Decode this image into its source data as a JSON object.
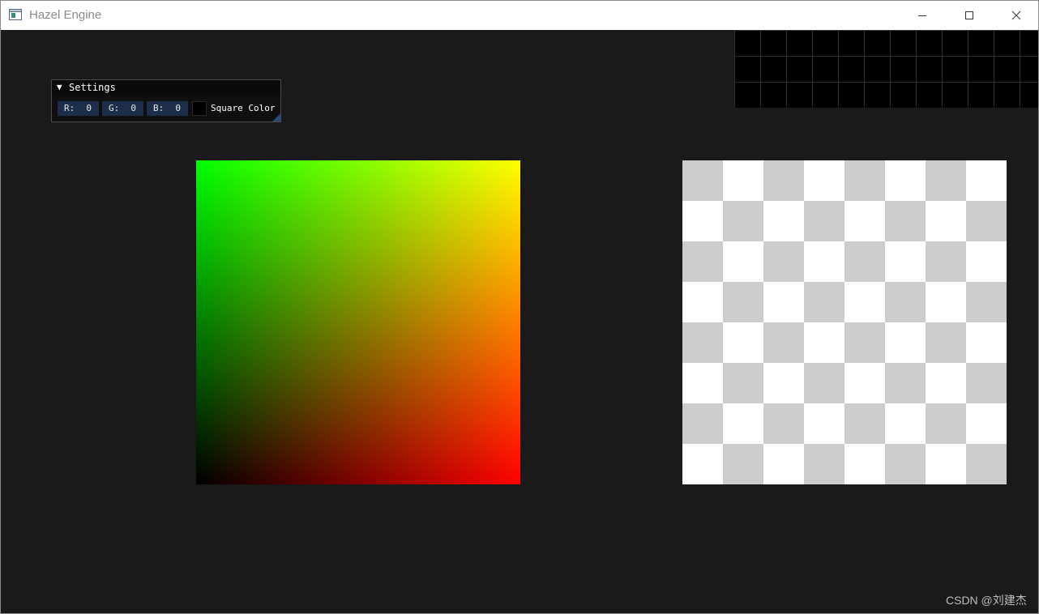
{
  "window": {
    "title": "Hazel Engine"
  },
  "settings_panel": {
    "title": "Settings",
    "collapse_glyph": "▼",
    "fields": [
      {
        "label": "R:",
        "value": "0"
      },
      {
        "label": "G:",
        "value": "0"
      },
      {
        "label": "B:",
        "value": "0"
      }
    ],
    "swatch_color": "#000000",
    "color_label": "Square Color"
  },
  "scene": {
    "gradient_square": {
      "corners": {
        "bottom_left": "#000000",
        "top_left": "#00ff00",
        "top_right": "#ffff00",
        "bottom_right": "#ff0000"
      }
    },
    "checker_square": {
      "light": "#ffffff",
      "dark": "#cccccc",
      "cells": 8
    }
  },
  "watermark": "CSDN @刘建杰",
  "colors": {
    "background": "#1a1a1a",
    "field_bg": "#1e2e4a",
    "panel_bg": "#0f0f0f"
  }
}
